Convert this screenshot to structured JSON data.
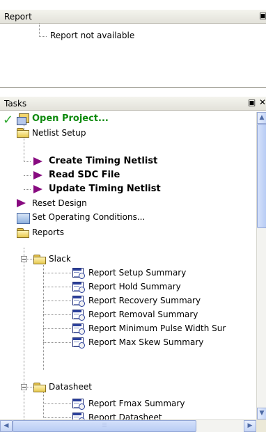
{
  "report": {
    "title": "Report",
    "message": "Report not available",
    "float_icon": "float-icon"
  },
  "tasks": {
    "title": "Tasks",
    "float_icon": "float-icon",
    "close_icon": "close-icon",
    "items": [
      {
        "label": "Open Project...",
        "icon": "project-icon",
        "status": "check-icon"
      },
      {
        "label": "Netlist Setup",
        "icon": "folder-icon"
      },
      {
        "label": "Create Timing Netlist",
        "icon": "flag-icon"
      },
      {
        "label": "Read SDC File",
        "icon": "flag-icon"
      },
      {
        "label": "Update Timing Netlist",
        "icon": "flag-icon"
      },
      {
        "label": "Reset Design",
        "icon": "flag-icon"
      },
      {
        "label": "Set Operating Conditions...",
        "icon": "settings-icon"
      },
      {
        "label": "Reports",
        "icon": "folder-icon"
      },
      {
        "label": "Slack",
        "icon": "folder-icon"
      },
      {
        "label": "Report Setup Summary",
        "icon": "report-icon"
      },
      {
        "label": "Report Hold Summary",
        "icon": "report-icon"
      },
      {
        "label": "Report Recovery Summary",
        "icon": "report-icon"
      },
      {
        "label": "Report Removal Summary",
        "icon": "report-icon"
      },
      {
        "label": "Report Minimum Pulse Width Sur",
        "icon": "report-icon"
      },
      {
        "label": "Report Max Skew Summary",
        "icon": "report-icon"
      },
      {
        "label": "Datasheet",
        "icon": "folder-icon"
      },
      {
        "label": "Report Fmax Summary",
        "icon": "report-icon"
      },
      {
        "label": "Report Datasheet",
        "icon": "report-icon"
      }
    ]
  },
  "colors": {
    "accent_green": "#0f8a0f",
    "flag_purple": "#880a80",
    "header_bg": "#ece9d8"
  }
}
